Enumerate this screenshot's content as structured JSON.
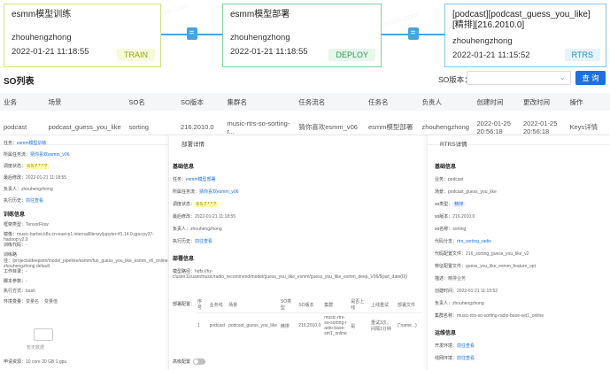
{
  "pipeline": {
    "train": {
      "title": "esmm模型训练",
      "owner": "zhouhengzhong",
      "time": "2022-01-21 11:18:55",
      "tag": "TRAIN"
    },
    "deploy": {
      "title": "esmm模型部署",
      "owner": "zhouhengzhong",
      "time": "2022-01-21 11:18:55",
      "tag": "DEPLOY"
    },
    "rtrs": {
      "title": "[podcast][podcast_guess_you_like][精排][216.2010.0]",
      "owner": "zhouhengzhong",
      "time": "2022-01-21 11:15:52",
      "tag": "RTRS"
    },
    "arrow_symbol": "="
  },
  "so": {
    "title": "SO列表",
    "version_label": "SO版本：",
    "select_chevron": "⌄",
    "search_button": "查 询",
    "columns": [
      "业务",
      "场景",
      "SO名",
      "SO版本",
      "集群名",
      "任务流名",
      "任务名",
      "负责人",
      "创建时间",
      "更改时间",
      "操作"
    ],
    "row": {
      "biz": "podcast",
      "scene": "podcast_guess_you_like",
      "so_name": "sorting",
      "so_version": "216.2010.0",
      "cluster": "music-rtrs-so-sorting-r...",
      "flow": "猜你喜欢esmm_v06",
      "task": "esmm模型部署",
      "owner": "zhouhengzhong",
      "created": "2022-01-25 20:56:18",
      "updated": "2022-01-25 20:56:18",
      "op": "Keys详情"
    }
  },
  "train_panel": {
    "task_label": "任务：",
    "task": "esmm模型训练",
    "flow_label": "所属任务流：",
    "flow": "猜你喜欢esmm_v06",
    "status_label": "调度状态：",
    "status": "6 5 7 * * ?",
    "modified_label": "最后修改：",
    "modified": "2022-01-21 11:18:55",
    "owner_label": "负责人：",
    "owner": "zhouhengzhong",
    "history_label": "执行历史：",
    "history": "前往查看",
    "section": "训练信息",
    "framework_label": "框架类型：",
    "framework": "TensorFlow",
    "image_label": "镜像：",
    "image": "music-harbor.k8s.cn-east-p1.internal/library/jupyter-tf1.14.0-gpu-py37-hadoop:v2.0",
    "code_label": "训练代码：",
    "code": "-",
    "dir_label": "训练路径：",
    "dir": "/projects/deepsim/model_pipeline/esmm/fun_guess_you_like_esmm_v6_online.sh zhouhengzhong default",
    "workdir_label": "工作目录：",
    "workdir": "-",
    "script_label": "脚本参数：",
    "script": "-",
    "exec_label": "执行方式：",
    "exec": "bash",
    "env_label": "环境变量：",
    "env1": "变量名",
    "env2": "变量值",
    "empty": "暂无数据",
    "resource_label": "申请资源：",
    "resource": "10 core 30 GB 1 gpu"
  },
  "deploy_panel": {
    "header": "部署详情",
    "basic": "基础信息",
    "task_label": "任务：",
    "task": "esmm模型部署",
    "flow_label": "所属任务流：",
    "flow": "猜你喜欢esmm_v06",
    "status_label": "调度状态：",
    "status": "6 5 7 * * ?",
    "modified_label": "最后修改：",
    "modified": "2022-01-21 11:18:55",
    "owner_label": "负责人：",
    "owner": "zhouhengzhong",
    "history_label": "执行历史：",
    "history": "前往查看",
    "deploy_sec": "部署信息",
    "model_path_label": "模型路径：",
    "model_path": "hdfs://hz-cluster11/user/music/radio_recommend/model/guess_you_like_esmm/guess_you_like_esmm_deep_V06/${ast_date(0)}",
    "config_label": "部署配置：",
    "columns": [
      "序号",
      "业务线",
      "场景",
      "SO类型",
      "SO版本",
      "集群",
      "是否上线",
      "上线重试",
      "部署文件"
    ],
    "row": [
      "1",
      "podcast",
      "podcast_guess_you_like",
      "精排",
      "216.2010.0",
      "music-rtrs-so-sorting-radio-base-set1_online",
      "是",
      "重试3次，间隔1分钟",
      "{\"name...}"
    ],
    "advanced": "高级配置"
  },
  "rtrs_panel": {
    "header": "RTRS详情",
    "basic": "基础信息",
    "biz_label": "业务：",
    "biz": "podcast",
    "scene_label": "场景：",
    "scene": "podcast_guess_you_like",
    "so_type_label": "so类型：",
    "so_type": "精排",
    "so_version_label": "so版本：",
    "so_version": "216.2010.0",
    "so_name_label": "so名称：",
    "so_name": "sorting",
    "branch_label": "代码分支：",
    "branch": "rtrs_sorting_radio",
    "config_label": "代码配置文件：",
    "config": "216_sorting_guess_you_like_v2",
    "feature_label": "特征配置文件：",
    "feature": "guess_you_like_esmm_feature_opt",
    "desc_label": "描述：",
    "desc": "精排业务",
    "created_label": "创建时间：",
    "created": "2022-01-21 11:15:52",
    "owner_label": "负责人：",
    "owner": "zhouhengzhong",
    "cluster_label": "集群名称：",
    "cluster": "music-rtrs-so-sorting-radio-base-set1_online",
    "env_sec": "运维信息",
    "dev_label": "开发环境：",
    "dev": "前往查看",
    "online_label": "线网环境：",
    "online": "前往查看"
  }
}
